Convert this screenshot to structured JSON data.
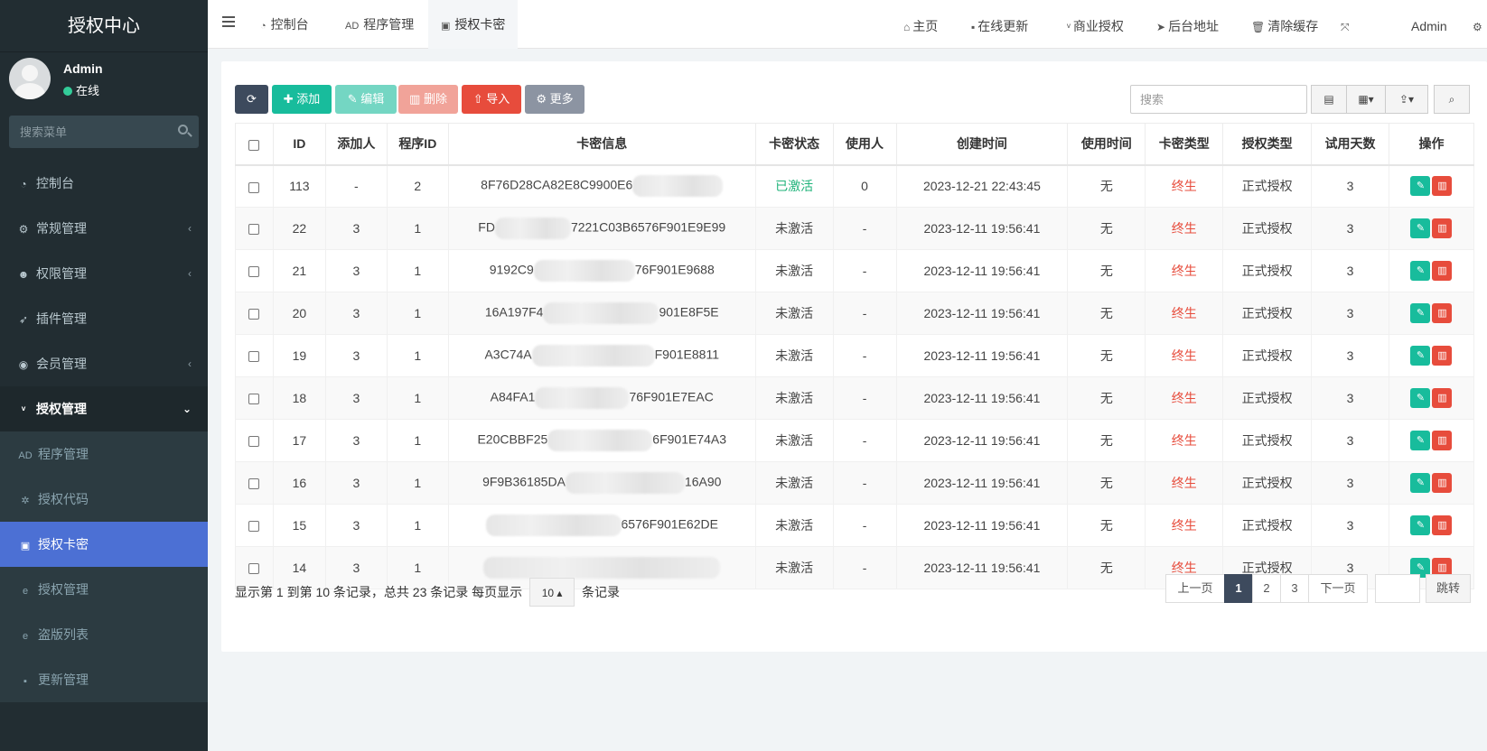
{
  "sidebar": {
    "brand": "授权中心",
    "user": {
      "name": "Admin",
      "status": "在线"
    },
    "search_placeholder": "搜索菜单",
    "menu": [
      {
        "label": "控制台",
        "icon": "dashboard-icon"
      },
      {
        "label": "常规管理",
        "icon": "cogs-icon"
      },
      {
        "label": "权限管理",
        "icon": "group-icon"
      },
      {
        "label": "插件管理",
        "icon": "rocket-icon"
      },
      {
        "label": "会员管理",
        "icon": "user-circle-icon"
      },
      {
        "label": "授权管理",
        "icon": "vimeo-icon"
      }
    ],
    "submenu": [
      {
        "label": "程序管理",
        "icon": "adn-icon"
      },
      {
        "label": "授权代码",
        "icon": "bug-icon"
      },
      {
        "label": "授权卡密",
        "icon": "id-card-icon"
      },
      {
        "label": "授权管理",
        "icon": "edge-icon"
      },
      {
        "label": "盗版列表",
        "icon": "edge-icon"
      },
      {
        "label": "更新管理",
        "icon": "vimeo-square-icon"
      }
    ]
  },
  "header": {
    "tabs": [
      "控制台",
      "程序管理",
      "授权卡密"
    ],
    "nav": [
      "主页",
      "在线更新",
      "商业授权",
      "后台地址",
      "清除缓存"
    ],
    "admin": "Admin"
  },
  "toolbar": {
    "add": "添加",
    "edit": "编辑",
    "delete": "删除",
    "import": "导入",
    "more": "更多",
    "search_placeholder": "搜索"
  },
  "table": {
    "headers": [
      "ID",
      "添加人",
      "程序ID",
      "卡密信息",
      "卡密状态",
      "使用人",
      "创建时间",
      "使用时间",
      "卡密类型",
      "授权类型",
      "试用天数",
      "操作"
    ],
    "rows": [
      {
        "id": "113",
        "adder": "-",
        "pid": "2",
        "key_pre": "8F76D28CA82E8C9900E6",
        "key_post": "",
        "blur": 100,
        "status": "已激活",
        "user": "0",
        "created": "2023-12-21 22:43:45",
        "used": "无",
        "ktype": "终生",
        "atype": "正式授权",
        "days": "3"
      },
      {
        "id": "22",
        "adder": "3",
        "pid": "1",
        "key_pre": "FD",
        "key_post": "7221C03B6576F901E9E99",
        "blur": 84,
        "status": "未激活",
        "user": "-",
        "created": "2023-12-11 19:56:41",
        "used": "无",
        "ktype": "终生",
        "atype": "正式授权",
        "days": "3"
      },
      {
        "id": "21",
        "adder": "3",
        "pid": "1",
        "key_pre": "9192C9",
        "key_post": "76F901E9688",
        "blur": 112,
        "status": "未激活",
        "user": "-",
        "created": "2023-12-11 19:56:41",
        "used": "无",
        "ktype": "终生",
        "atype": "正式授权",
        "days": "3"
      },
      {
        "id": "20",
        "adder": "3",
        "pid": "1",
        "key_pre": "16A197F4",
        "key_post": "901E8F5E",
        "blur": 128,
        "status": "未激活",
        "user": "-",
        "created": "2023-12-11 19:56:41",
        "used": "无",
        "ktype": "终生",
        "atype": "正式授权",
        "days": "3"
      },
      {
        "id": "19",
        "adder": "3",
        "pid": "1",
        "key_pre": "A3C74A",
        "key_post": "F901E8811",
        "blur": 136,
        "status": "未激活",
        "user": "-",
        "created": "2023-12-11 19:56:41",
        "used": "无",
        "ktype": "终生",
        "atype": "正式授权",
        "days": "3"
      },
      {
        "id": "18",
        "adder": "3",
        "pid": "1",
        "key_pre": "A84FA1",
        "key_post": "76F901E7EAC",
        "blur": 104,
        "status": "未激活",
        "user": "-",
        "created": "2023-12-11 19:56:41",
        "used": "无",
        "ktype": "终生",
        "atype": "正式授权",
        "days": "3"
      },
      {
        "id": "17",
        "adder": "3",
        "pid": "1",
        "key_pre": "E20CBBF25",
        "key_post": "6F901E74A3",
        "blur": 116,
        "status": "未激活",
        "user": "-",
        "created": "2023-12-11 19:56:41",
        "used": "无",
        "ktype": "终生",
        "atype": "正式授权",
        "days": "3"
      },
      {
        "id": "16",
        "adder": "3",
        "pid": "1",
        "key_pre": "9F9B36185DA",
        "key_post": "16A90",
        "blur": 132,
        "status": "未激活",
        "user": "-",
        "created": "2023-12-11 19:56:41",
        "used": "无",
        "ktype": "终生",
        "atype": "正式授权",
        "days": "3"
      },
      {
        "id": "15",
        "adder": "3",
        "pid": "1",
        "key_pre": "",
        "key_post": "6576F901E62DE",
        "blur": 150,
        "status": "未激活",
        "user": "-",
        "created": "2023-12-11 19:56:41",
        "used": "无",
        "ktype": "终生",
        "atype": "正式授权",
        "days": "3"
      },
      {
        "id": "14",
        "adder": "3",
        "pid": "1",
        "key_pre": "",
        "key_post": "",
        "blur": 262,
        "status": "未激活",
        "user": "-",
        "created": "2023-12-11 19:56:41",
        "used": "无",
        "ktype": "终生",
        "atype": "正式授权",
        "days": "3"
      }
    ]
  },
  "footer": {
    "info_pre": "显示第 1 到第 10 条记录，总共 23 条记录 每页显示",
    "page_size": "10",
    "info_post": "条记录",
    "prev": "上一页",
    "pages": [
      "1",
      "2",
      "3"
    ],
    "next": "下一页",
    "jump": "跳转"
  }
}
